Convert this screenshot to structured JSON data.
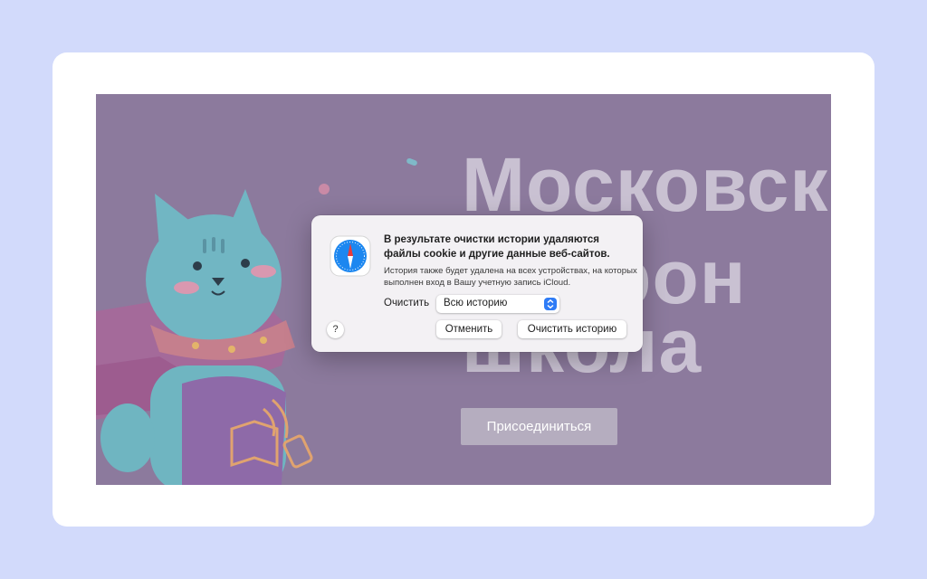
{
  "background": {
    "headline_line1": "Московск",
    "headline_line2": "трон",
    "headline_line3": "школа",
    "join_button": "Присоединиться"
  },
  "dialog": {
    "icon": "safari-compass-icon",
    "title": "В результате очистки истории удаляются файлы cookie и другие данные веб-сайтов.",
    "body": "История также будет удалена на всех устройствах, на которых выполнен вход в Вашу учетную запись iCloud.",
    "clear_label": "Очистить",
    "clear_range_selected": "Всю историю",
    "help_label": "?",
    "cancel_button": "Отменить",
    "confirm_button": "Очистить историю"
  },
  "colors": {
    "page_background": "#d2dafb",
    "overlay": "#8c7a9d",
    "select_accent": "#2f7cf6"
  }
}
